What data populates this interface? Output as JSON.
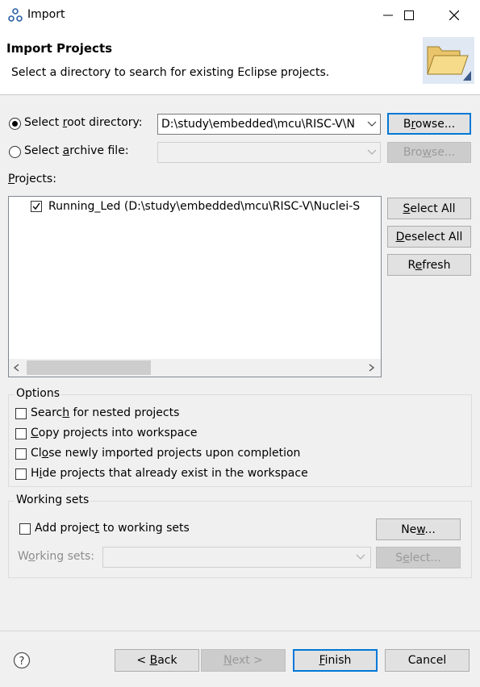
{
  "window": {
    "title": "Import"
  },
  "header": {
    "title": "Import Projects",
    "subtitle": "Select a directory to search for existing Eclipse projects."
  },
  "source": {
    "root_label": "Select root directory:",
    "root_value": "D:\\study\\embedded\\mcu\\RISC-V\\N",
    "archive_label": "Select archive file:",
    "browse_label": "Browse...",
    "browse_archive_label": "Browse..."
  },
  "projects": {
    "label": "Projects:",
    "items": [
      {
        "label": "Running_Led (D:\\study\\embedded\\mcu\\RISC-V\\Nuclei-S",
        "checked": true
      }
    ],
    "select_all": "Select All",
    "deselect_all": "Deselect All",
    "refresh": "Refresh"
  },
  "options": {
    "title": "Options",
    "items": [
      "Search for nested projects",
      "Copy projects into workspace",
      "Close newly imported projects upon completion",
      "Hide projects that already exist in the workspace"
    ]
  },
  "working_sets": {
    "title": "Working sets",
    "add_label": "Add project to working sets",
    "new_button": "New...",
    "sets_label": "Working sets:",
    "select_button": "Select..."
  },
  "footer": {
    "back": "< Back",
    "next": "Next >",
    "finish": "Finish",
    "cancel": "Cancel"
  },
  "colors": {
    "accent": "#0078d7",
    "checkmark": "#000000"
  }
}
